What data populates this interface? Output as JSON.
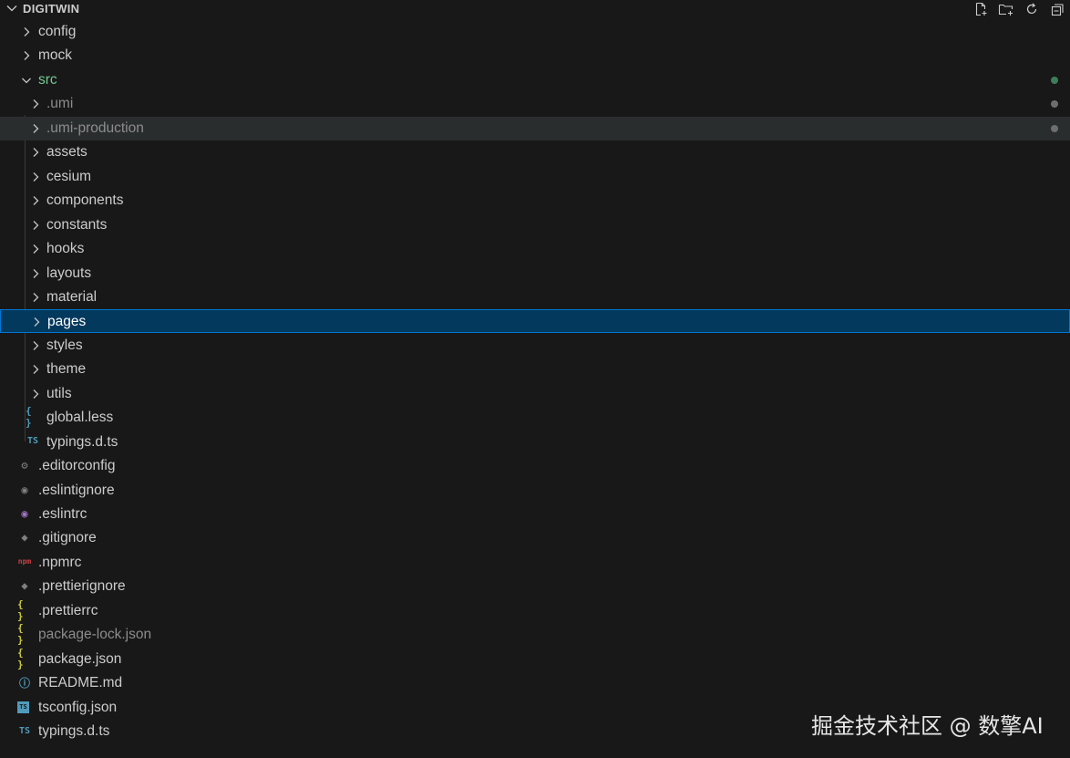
{
  "explorer": {
    "title": "DIGITWIN",
    "actions": [
      {
        "name": "new-file-icon"
      },
      {
        "name": "new-folder-icon"
      },
      {
        "name": "refresh-icon"
      },
      {
        "name": "collapse-all-icon"
      }
    ]
  },
  "tree": {
    "items": [
      {
        "label": "config",
        "type": "folder",
        "expanded": false,
        "depth": 0
      },
      {
        "label": "mock",
        "type": "folder",
        "expanded": false,
        "depth": 0
      },
      {
        "label": "src",
        "type": "folder",
        "expanded": true,
        "depth": 0,
        "status": "modified"
      },
      {
        "label": ".umi",
        "type": "folder",
        "expanded": false,
        "depth": 1,
        "status": "ignored"
      },
      {
        "label": ".umi-production",
        "type": "folder",
        "expanded": false,
        "depth": 1,
        "status": "ignored",
        "hover": true
      },
      {
        "label": "assets",
        "type": "folder",
        "expanded": false,
        "depth": 1
      },
      {
        "label": "cesium",
        "type": "folder",
        "expanded": false,
        "depth": 1
      },
      {
        "label": "components",
        "type": "folder",
        "expanded": false,
        "depth": 1
      },
      {
        "label": "constants",
        "type": "folder",
        "expanded": false,
        "depth": 1
      },
      {
        "label": "hooks",
        "type": "folder",
        "expanded": false,
        "depth": 1
      },
      {
        "label": "layouts",
        "type": "folder",
        "expanded": false,
        "depth": 1
      },
      {
        "label": "material",
        "type": "folder",
        "expanded": false,
        "depth": 1
      },
      {
        "label": "pages",
        "type": "folder",
        "expanded": false,
        "depth": 1,
        "selected": true
      },
      {
        "label": "styles",
        "type": "folder",
        "expanded": false,
        "depth": 1
      },
      {
        "label": "theme",
        "type": "folder",
        "expanded": false,
        "depth": 1
      },
      {
        "label": "utils",
        "type": "folder",
        "expanded": false,
        "depth": 1
      },
      {
        "label": "global.less",
        "type": "file",
        "icon": "less-file-icon",
        "glyph": "{ }",
        "depth": 1
      },
      {
        "label": "typings.d.ts",
        "type": "file",
        "icon": "typescript-file-icon",
        "glyph": "TS",
        "depth": 1
      },
      {
        "label": ".editorconfig",
        "type": "file",
        "icon": "gear-icon",
        "glyph": "⚙",
        "depth": 0
      },
      {
        "label": ".eslintignore",
        "type": "file",
        "icon": "eslint-ignore-icon",
        "glyph": "◉",
        "depth": 0
      },
      {
        "label": ".eslintrc",
        "type": "file",
        "icon": "eslint-icon",
        "glyph": "◉",
        "depth": 0
      },
      {
        "label": ".gitignore",
        "type": "file",
        "icon": "git-icon",
        "glyph": "◆",
        "depth": 0
      },
      {
        "label": ".npmrc",
        "type": "file",
        "icon": "npm-icon",
        "glyph": "npm",
        "depth": 0
      },
      {
        "label": ".prettierignore",
        "type": "file",
        "icon": "git-icon",
        "glyph": "◆",
        "depth": 0
      },
      {
        "label": ".prettierrc",
        "type": "file",
        "icon": "json-file-icon",
        "glyph": "{ }",
        "depth": 0
      },
      {
        "label": "package-lock.json",
        "type": "file",
        "icon": "json-file-icon",
        "glyph": "{ }",
        "depth": 0,
        "dim": true
      },
      {
        "label": "package.json",
        "type": "file",
        "icon": "json-file-icon",
        "glyph": "{ }",
        "depth": 0
      },
      {
        "label": "README.md",
        "type": "file",
        "icon": "info-icon",
        "glyph": "ⓘ",
        "depth": 0
      },
      {
        "label": "tsconfig.json",
        "type": "file",
        "icon": "tsconfig-file-icon",
        "glyph": "TS",
        "depth": 0
      },
      {
        "label": "typings.d.ts",
        "type": "file",
        "icon": "typescript-file-icon",
        "glyph": "TS",
        "depth": 0
      }
    ]
  },
  "watermark": "掘金技术社区 @ 数擎AI",
  "colors": {
    "background": "#181818",
    "selection": "#04395e",
    "selection_border": "#0078d4",
    "hover": "#2a2d2e",
    "modified_green": "#73c991",
    "ignored_gray": "#8c8c8c",
    "ts_blue": "#519aba",
    "json_yellow": "#cbcb41",
    "eslint_purple": "#a074c4",
    "npm_red": "#cc3e44"
  }
}
